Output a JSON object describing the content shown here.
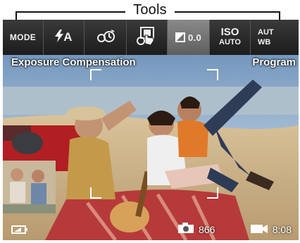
{
  "callout": {
    "title": "Tools"
  },
  "toolbar": {
    "mode": "MODE",
    "flash": "A",
    "ev_value": "0.0",
    "iso_line1": "ISO",
    "iso_line2": "AUTO",
    "wb_line1": "AUT",
    "wb_line2": "WB"
  },
  "labels": {
    "left": "Exposure Compensation",
    "right": "Program"
  },
  "status": {
    "pictures_remaining": "866",
    "recording_time": "8:08"
  },
  "icons": {
    "mode": "mode-icon",
    "flash": "flash-icon",
    "timer": "self-timer-icon",
    "touch": "touch-shutter-icon",
    "ev": "exposure-icon",
    "battery": "battery-icon",
    "camera": "camera-icon",
    "video": "video-icon"
  }
}
